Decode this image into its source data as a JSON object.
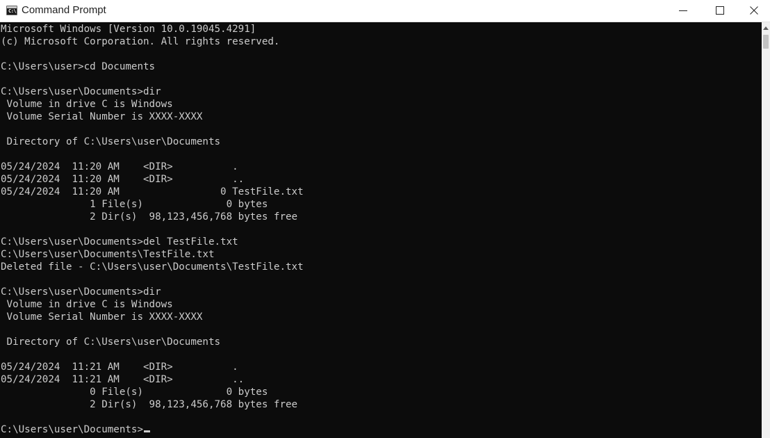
{
  "window": {
    "title": "Command Prompt"
  },
  "icons": {
    "app": "command-prompt-icon",
    "minimize": "minimize-icon",
    "maximize": "maximize-icon",
    "close": "close-icon",
    "scroll_up": "chevron-up-icon",
    "app_glyph": "C:\\"
  },
  "colors": {
    "console_background": "#0c0c0c",
    "console_text": "#cccccc",
    "titlebar_background": "#ffffff"
  },
  "console": {
    "lines": [
      "Microsoft Windows [Version 10.0.19045.4291]",
      "(c) Microsoft Corporation. All rights reserved.",
      "",
      "C:\\Users\\user>cd Documents",
      "",
      "C:\\Users\\user\\Documents>dir",
      " Volume in drive C is Windows",
      " Volume Serial Number is XXXX-XXXX",
      "",
      " Directory of C:\\Users\\user\\Documents",
      "",
      "05/24/2024  11:20 AM    <DIR>          .",
      "05/24/2024  11:20 AM    <DIR>          ..",
      "05/24/2024  11:20 AM                 0 TestFile.txt",
      "               1 File(s)              0 bytes",
      "               2 Dir(s)  98,123,456,768 bytes free",
      "",
      "C:\\Users\\user\\Documents>del TestFile.txt",
      "C:\\Users\\user\\Documents\\TestFile.txt",
      "Deleted file - C:\\Users\\user\\Documents\\TestFile.txt",
      "",
      "C:\\Users\\user\\Documents>dir",
      " Volume in drive C is Windows",
      " Volume Serial Number is XXXX-XXXX",
      "",
      " Directory of C:\\Users\\user\\Documents",
      "",
      "05/24/2024  11:21 AM    <DIR>          .",
      "05/24/2024  11:21 AM    <DIR>          ..",
      "               0 File(s)              0 bytes",
      "               2 Dir(s)  98,123,456,768 bytes free",
      ""
    ],
    "prompt": "C:\\Users\\user\\Documents>"
  }
}
